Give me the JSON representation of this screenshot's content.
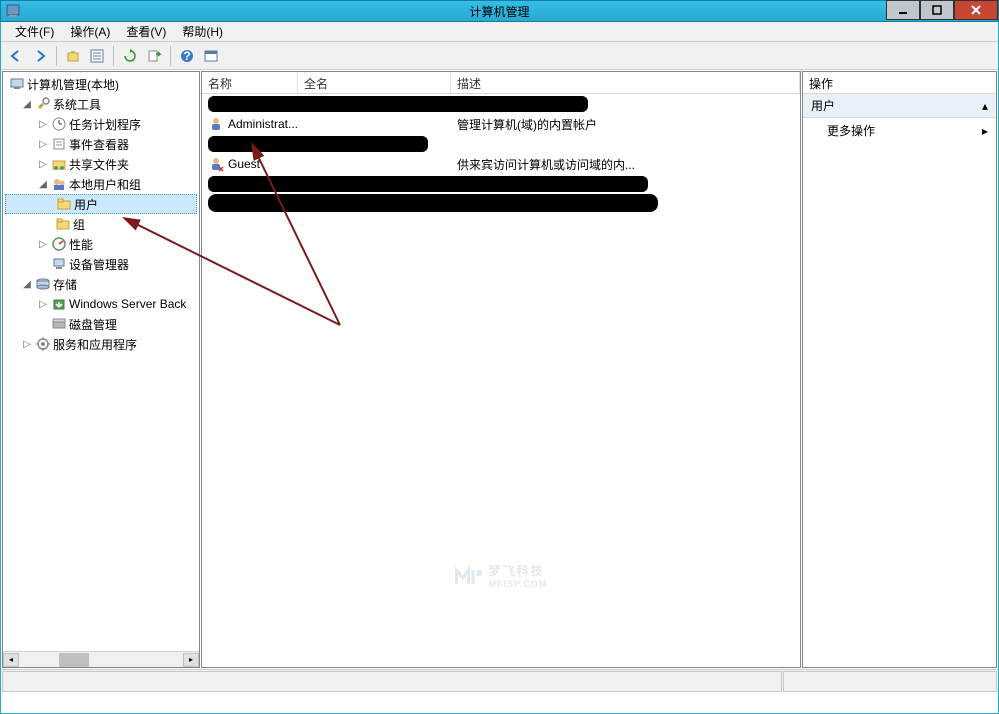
{
  "window": {
    "title": "计算机管理"
  },
  "menu": {
    "file": "文件(F)",
    "action": "操作(A)",
    "view": "查看(V)",
    "help": "帮助(H)"
  },
  "tree": {
    "root": "计算机管理(本地)",
    "system_tools": "系统工具",
    "task_scheduler": "任务计划程序",
    "event_viewer": "事件查看器",
    "shared_folders": "共享文件夹",
    "local_users_groups": "本地用户和组",
    "users": "用户",
    "groups": "组",
    "performance": "性能",
    "device_manager": "设备管理器",
    "storage": "存储",
    "wsb": "Windows Server Back",
    "disk_mgmt": "磁盘管理",
    "services_apps": "服务和应用程序"
  },
  "list": {
    "header_name": "名称",
    "header_full": "全名",
    "header_desc": "描述",
    "rows": [
      {
        "name": "Administrat...",
        "desc": "管理计算机(域)的内置帐户"
      },
      {
        "name": "Guest",
        "desc": "供来宾访问计算机或访问域的内..."
      }
    ]
  },
  "actions": {
    "header": "操作",
    "section": "用户",
    "more": "更多操作"
  },
  "watermark": {
    "brand": "梦飞科技",
    "url": "MFISP.COM"
  }
}
